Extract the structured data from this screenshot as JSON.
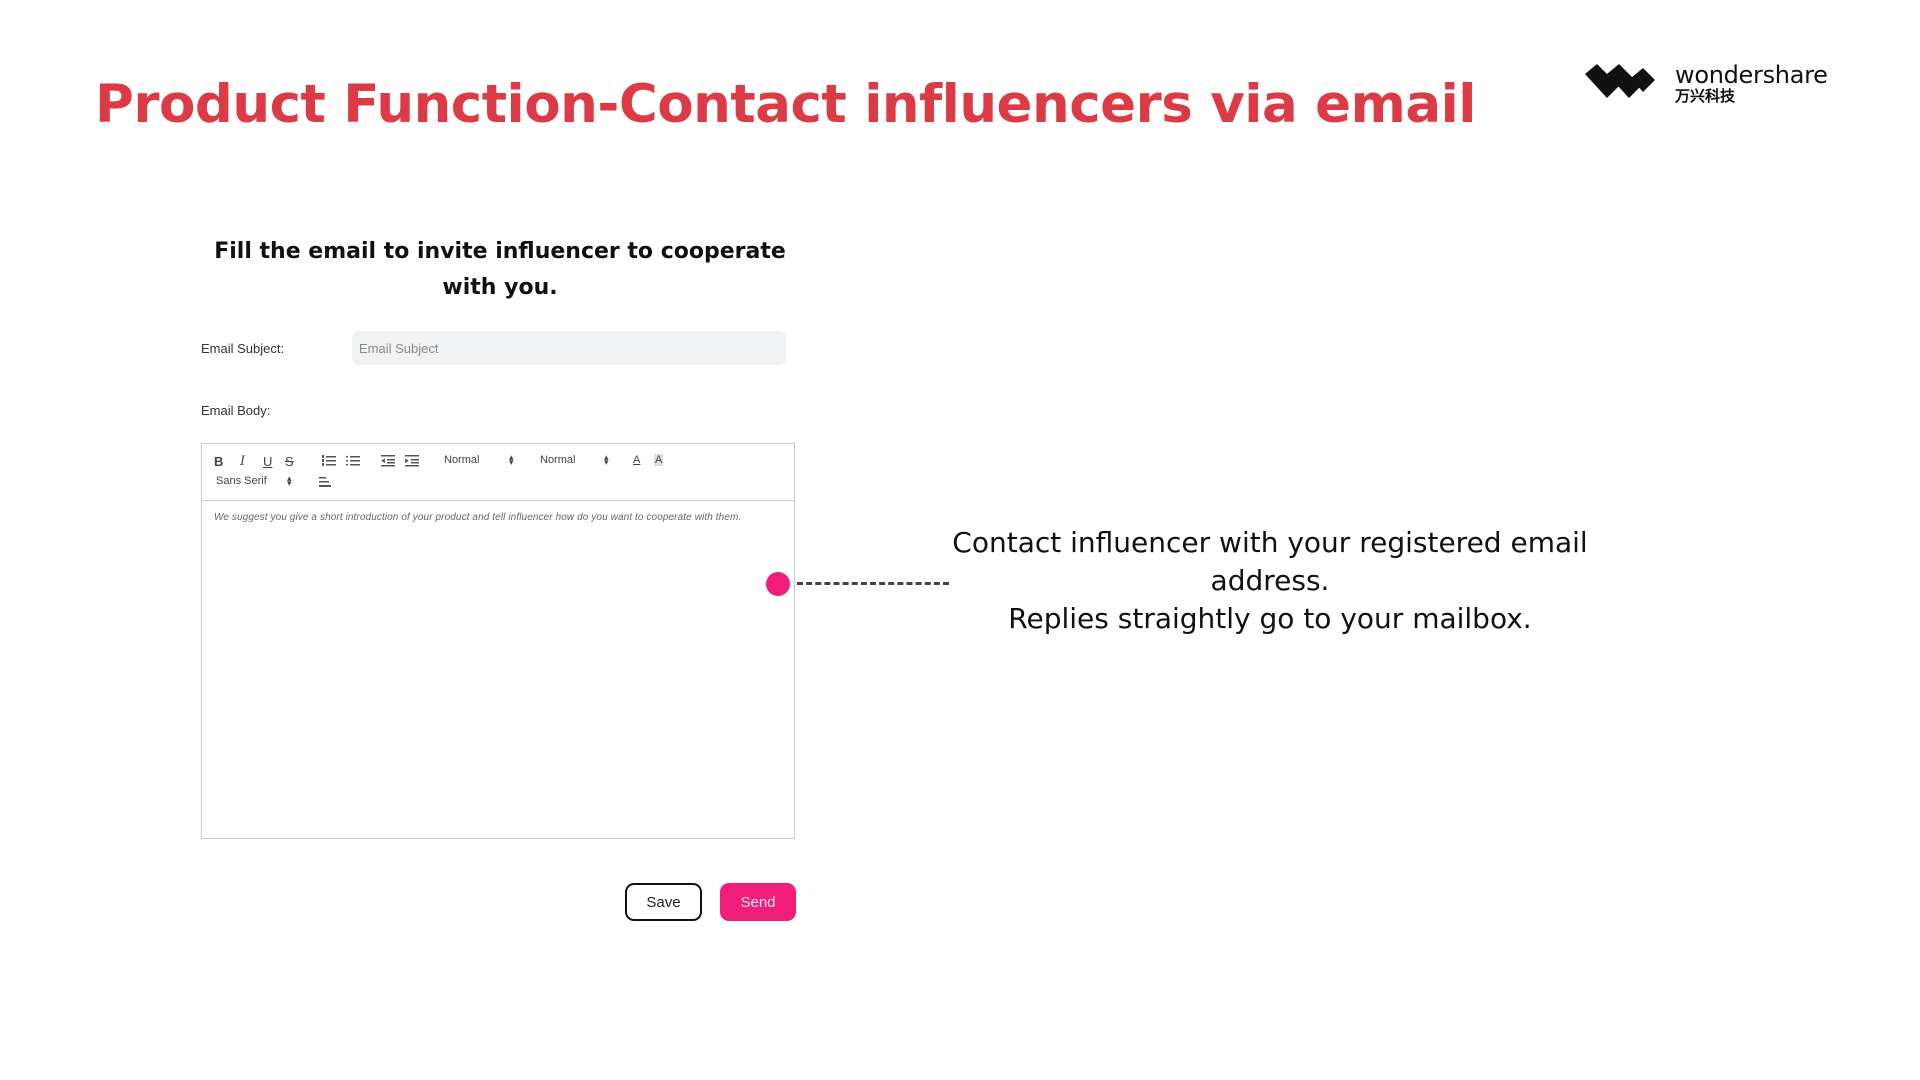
{
  "slide": {
    "title": "Product Function-Contact influencers via email",
    "logo": {
      "name": "wondershare",
      "subtitle_cn": "万兴科技"
    }
  },
  "form": {
    "heading_line1": "Fill the email to invite influencer to cooperate",
    "heading_line2": "with you.",
    "subject_label": "Email Subject:",
    "subject_placeholder": "Email Subject",
    "subject_value": "",
    "body_label": "Email Body:",
    "toolbar": {
      "bold": "B",
      "italic": "I",
      "underline": "U",
      "strike": "S",
      "heading_select": "Normal",
      "size_select": "Normal",
      "font_select": "Sans Serif",
      "font_color": "A",
      "background_color": "A"
    },
    "body_placeholder": "We suggest you give a short introduction of your product and tell influencer how do you want to cooperate with them.",
    "save_label": "Save",
    "send_label": "Send"
  },
  "callout": {
    "line1": "Contact influencer with your registered email",
    "line2": "address.",
    "line3": "Replies straightly go to your mailbox."
  },
  "colors": {
    "title": "#dc3a45",
    "accent": "#f01d7a"
  }
}
